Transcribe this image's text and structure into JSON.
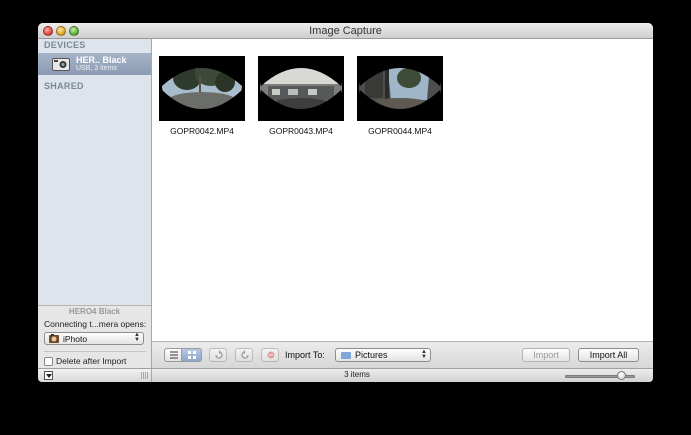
{
  "window": {
    "title": "Image Capture"
  },
  "sidebar": {
    "devices_header": "DEVICES",
    "shared_header": "SHARED",
    "device": {
      "name": "HER.. Black",
      "subtitle": "USB, 3 items"
    },
    "bottom": {
      "device_label": "HERO4 Black",
      "connect_label": "Connecting t...mera opens:",
      "app_value": "iPhoto",
      "delete_label": "Delete after Import",
      "delete_checked": false
    }
  },
  "thumbnails": [
    {
      "label": "GOPR0042.MP4"
    },
    {
      "label": "GOPR0043.MP4"
    },
    {
      "label": "GOPR0044.MP4"
    }
  ],
  "toolbar": {
    "import_to_label": "Import To:",
    "destination": "Pictures",
    "import_label": "Import",
    "import_all_label": "Import All"
  },
  "status": {
    "item_count": "3 items",
    "thumbnail_size": 0.8
  },
  "colors": {
    "sidebar_bg": "#dde4ec",
    "selection": "#8a9bb3",
    "accent": "#8ca6cc"
  }
}
